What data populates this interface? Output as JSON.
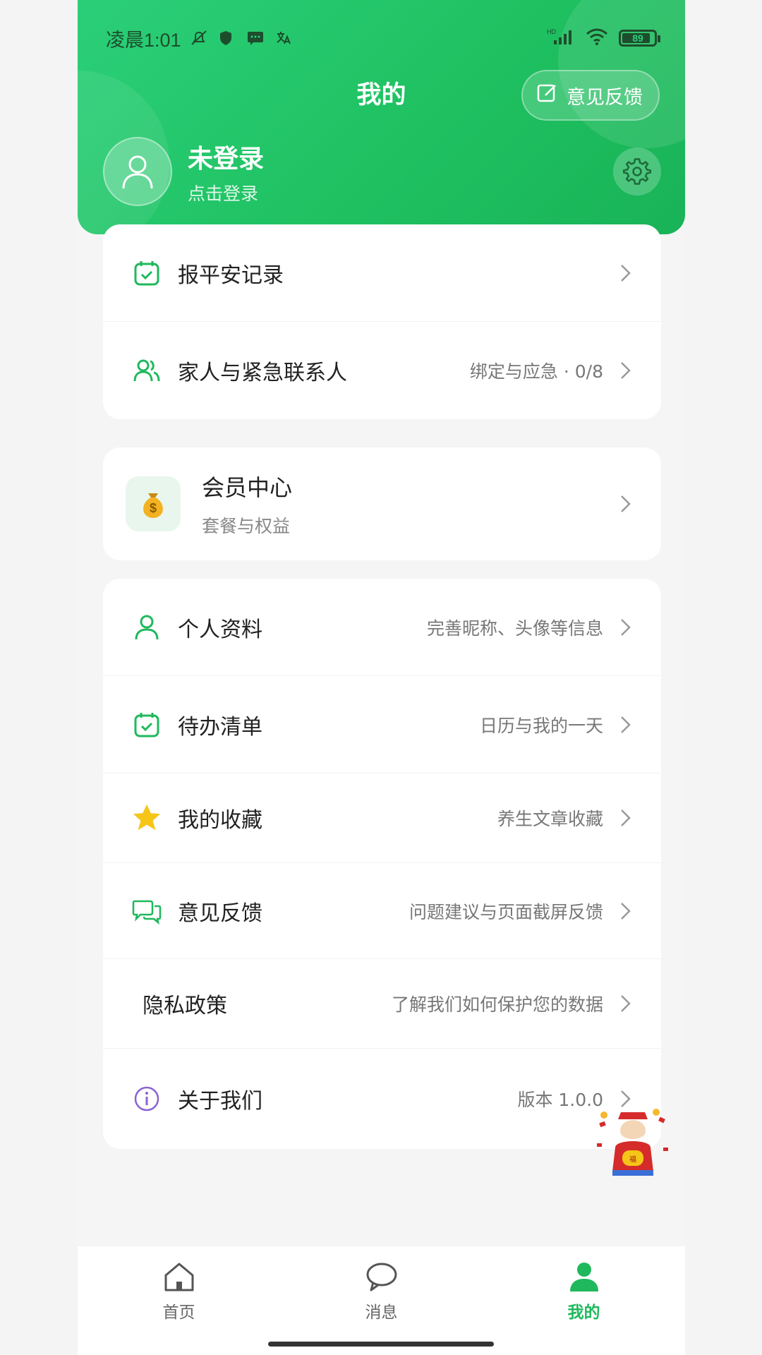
{
  "status_bar": {
    "time": "凌晨1:01",
    "battery": "89",
    "battery_level_percent": 89,
    "network_label": "HD"
  },
  "header": {
    "title": "我的",
    "feedback_button": "意见反馈",
    "user_name": "未登录",
    "user_sub": "点击登录"
  },
  "section1": {
    "items": [
      {
        "label": "报平安记录",
        "detail": "",
        "icon": "calendar-check-icon"
      },
      {
        "label": "家人与紧急联系人",
        "detail": "绑定与应急 · 0/8",
        "icon": "users-icon"
      }
    ]
  },
  "member": {
    "title": "会员中心",
    "subtitle": "套餐与权益",
    "icon": "money-bag-icon"
  },
  "section3": {
    "items": [
      {
        "label": "个人资料",
        "detail": "完善昵称、头像等信息",
        "icon": "user-icon"
      },
      {
        "label": "待办清单",
        "detail": "日历与我的一天",
        "icon": "calendar-check-icon"
      },
      {
        "label": "我的收藏",
        "detail": "养生文章收藏",
        "icon": "star-icon"
      },
      {
        "label": "意见反馈",
        "detail": "问题建议与页面截屏反馈",
        "icon": "chat-icon"
      },
      {
        "label": "隐私政策",
        "detail": "了解我们如何保护您的数据",
        "icon": ""
      },
      {
        "label": "关于我们",
        "detail": "版本 1.0.0",
        "icon": "info-icon"
      }
    ]
  },
  "tabbar": {
    "tabs": [
      {
        "label": "首页",
        "icon": "home-icon",
        "active": false
      },
      {
        "label": "消息",
        "icon": "message-icon",
        "active": false
      },
      {
        "label": "我的",
        "icon": "profile-icon",
        "active": true
      }
    ]
  },
  "colors": {
    "brand_green": "#1fc161",
    "active_tab": "#1fb85c",
    "info_purple": "#8a63d2",
    "star_yellow": "#f5c518"
  }
}
